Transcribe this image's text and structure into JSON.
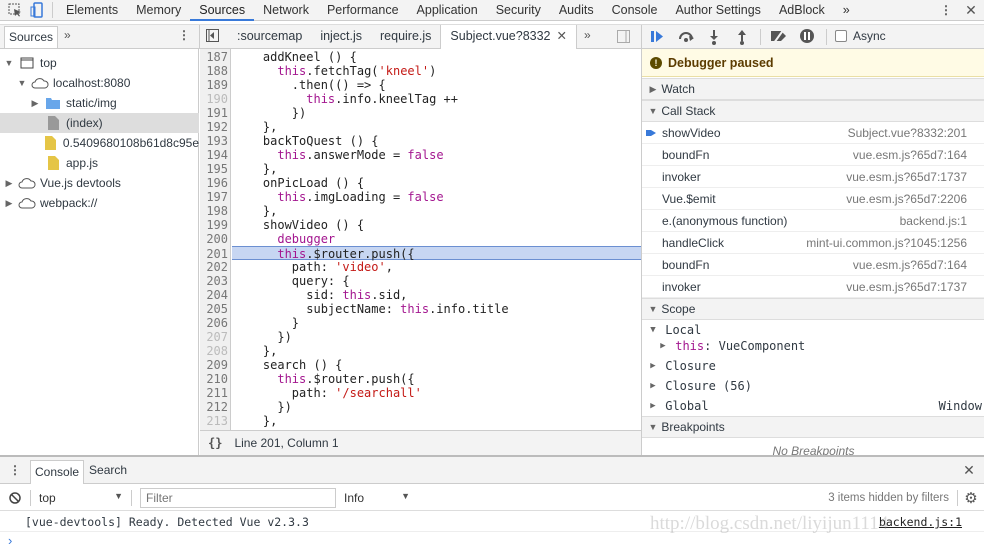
{
  "main_tabs": [
    "Elements",
    "Memory",
    "Sources",
    "Network",
    "Performance",
    "Application",
    "Security",
    "Audits",
    "Console",
    "Author Settings",
    "AdBlock"
  ],
  "active_main_tab": "Sources",
  "navigator": {
    "tab": "Sources",
    "tree": [
      {
        "label": "top",
        "depth": 0,
        "icon": "frame-icon",
        "arrow": "▼"
      },
      {
        "label": "localhost:8080",
        "depth": 1,
        "icon": "cloud-icon",
        "arrow": "▼"
      },
      {
        "label": "static/img",
        "depth": 2,
        "icon": "folder-icon",
        "arrow": "▶"
      },
      {
        "label": "(index)",
        "depth": 2,
        "icon": "file-icon",
        "arrow": "",
        "selected": true
      },
      {
        "label": "0.5409680108b61d8c95e",
        "depth": 2,
        "icon": "js-file-icon",
        "arrow": ""
      },
      {
        "label": "app.js",
        "depth": 2,
        "icon": "js-file-icon",
        "arrow": ""
      },
      {
        "label": "Vue.js devtools",
        "depth": 0,
        "icon": "cloud-icon",
        "arrow": "▶"
      },
      {
        "label": "webpack://",
        "depth": 0,
        "icon": "cloud-icon",
        "arrow": "▶"
      }
    ]
  },
  "editor_tabs": [
    ":sourcemap",
    "inject.js",
    "require.js",
    "Subject.vue?8332"
  ],
  "active_editor_tab": "Subject.vue?8332",
  "code": [
    {
      "n": "187",
      "s": [
        [
          "p",
          "    addKneel () {"
        ]
      ]
    },
    {
      "n": "188",
      "s": [
        [
          "p",
          "      "
        ],
        [
          "k",
          "this"
        ],
        [
          "p",
          ".fetchTag("
        ],
        [
          "s",
          "'kneel'"
        ],
        [
          "p",
          ")"
        ]
      ]
    },
    {
      "n": "189",
      "s": [
        [
          "p",
          "        .then(() => {"
        ]
      ]
    },
    {
      "n": "190",
      "dim": true,
      "s": [
        [
          "p",
          "          "
        ],
        [
          "k",
          "this"
        ],
        [
          "p",
          ".info.kneelTag ++"
        ]
      ]
    },
    {
      "n": "191",
      "s": [
        [
          "p",
          "        })"
        ]
      ]
    },
    {
      "n": "192",
      "s": [
        [
          "p",
          "    },"
        ]
      ]
    },
    {
      "n": "193",
      "s": [
        [
          "p",
          "    backToQuest () {"
        ]
      ]
    },
    {
      "n": "194",
      "s": [
        [
          "p",
          "      "
        ],
        [
          "k",
          "this"
        ],
        [
          "p",
          ".answerMode = "
        ],
        [
          "k",
          "false"
        ]
      ]
    },
    {
      "n": "195",
      "s": [
        [
          "p",
          "    },"
        ]
      ]
    },
    {
      "n": "196",
      "s": [
        [
          "p",
          "    onPicLoad () {"
        ]
      ]
    },
    {
      "n": "197",
      "s": [
        [
          "p",
          "      "
        ],
        [
          "k",
          "this"
        ],
        [
          "p",
          ".imgLoading = "
        ],
        [
          "k",
          "false"
        ]
      ]
    },
    {
      "n": "198",
      "s": [
        [
          "p",
          "    },"
        ]
      ]
    },
    {
      "n": "199",
      "s": [
        [
          "p",
          "    showVideo () {"
        ]
      ]
    },
    {
      "n": "200",
      "s": [
        [
          "p",
          "      "
        ],
        [
          "k",
          "debugger"
        ]
      ]
    },
    {
      "n": "201",
      "hl": true,
      "s": [
        [
          "p",
          "      "
        ],
        [
          "k",
          "this"
        ],
        [
          "p",
          ".$router.push({"
        ]
      ]
    },
    {
      "n": "202",
      "s": [
        [
          "p",
          "        path: "
        ],
        [
          "s",
          "'video'"
        ],
        [
          "p",
          ","
        ]
      ]
    },
    {
      "n": "203",
      "s": [
        [
          "p",
          "        query: {"
        ]
      ]
    },
    {
      "n": "204",
      "s": [
        [
          "p",
          "          sid: "
        ],
        [
          "k",
          "this"
        ],
        [
          "p",
          ".sid,"
        ]
      ]
    },
    {
      "n": "205",
      "s": [
        [
          "p",
          "          subjectName: "
        ],
        [
          "k",
          "this"
        ],
        [
          "p",
          ".info.title"
        ]
      ]
    },
    {
      "n": "206",
      "s": [
        [
          "p",
          "        }"
        ]
      ]
    },
    {
      "n": "207",
      "dim": true,
      "s": [
        [
          "p",
          "      })"
        ]
      ]
    },
    {
      "n": "208",
      "dim": true,
      "s": [
        [
          "p",
          "    },"
        ]
      ]
    },
    {
      "n": "209",
      "s": [
        [
          "p",
          "    search () {"
        ]
      ]
    },
    {
      "n": "210",
      "s": [
        [
          "p",
          "      "
        ],
        [
          "k",
          "this"
        ],
        [
          "p",
          ".$router.push({"
        ]
      ]
    },
    {
      "n": "211",
      "s": [
        [
          "p",
          "        path: "
        ],
        [
          "s",
          "'/searchall'"
        ]
      ]
    },
    {
      "n": "212",
      "s": [
        [
          "p",
          "      })"
        ]
      ]
    },
    {
      "n": "213",
      "dim": true,
      "s": [
        [
          "p",
          "    },"
        ]
      ]
    }
  ],
  "status_bar": {
    "format_icon": "{}",
    "position": "Line 201, Column 1"
  },
  "debugger": {
    "async_label": "Async",
    "paused_label": "Debugger paused",
    "watch_label": "Watch",
    "call_stack_label": "Call Stack",
    "call_stack": [
      {
        "fn": "showVideo",
        "loc": "Subject.vue?8332:201",
        "current": true
      },
      {
        "fn": "boundFn",
        "loc": "vue.esm.js?65d7:164"
      },
      {
        "fn": "invoker",
        "loc": "vue.esm.js?65d7:1737"
      },
      {
        "fn": "Vue.$emit",
        "loc": "vue.esm.js?65d7:2206"
      },
      {
        "fn": "e.(anonymous function)",
        "loc": "backend.js:1"
      },
      {
        "fn": "handleClick",
        "loc": "mint-ui.common.js?1045:1256"
      },
      {
        "fn": "boundFn",
        "loc": "vue.esm.js?65d7:164"
      },
      {
        "fn": "invoker",
        "loc": "vue.esm.js?65d7:1737"
      }
    ],
    "scope_label": "Scope",
    "scope": {
      "local": "Local",
      "this_key": "this",
      "this_val": ": VueComponent",
      "closure": "Closure",
      "closure56": "Closure (56)",
      "global": "Global",
      "global_val": "Window"
    },
    "breakpoints_label": "Breakpoints",
    "no_breakpoints": "No Breakpoints"
  },
  "drawer": {
    "tabs": [
      "Console",
      "Search"
    ],
    "context": "top",
    "filter_placeholder": "Filter",
    "level": "Info",
    "hidden": "3 items hidden by filters",
    "message": "[vue-devtools] Ready. Detected Vue v2.3.3",
    "message_source": "backend.js:1",
    "prompt": "›"
  },
  "watermark": "http://blog.csdn.net/liyijun1114"
}
